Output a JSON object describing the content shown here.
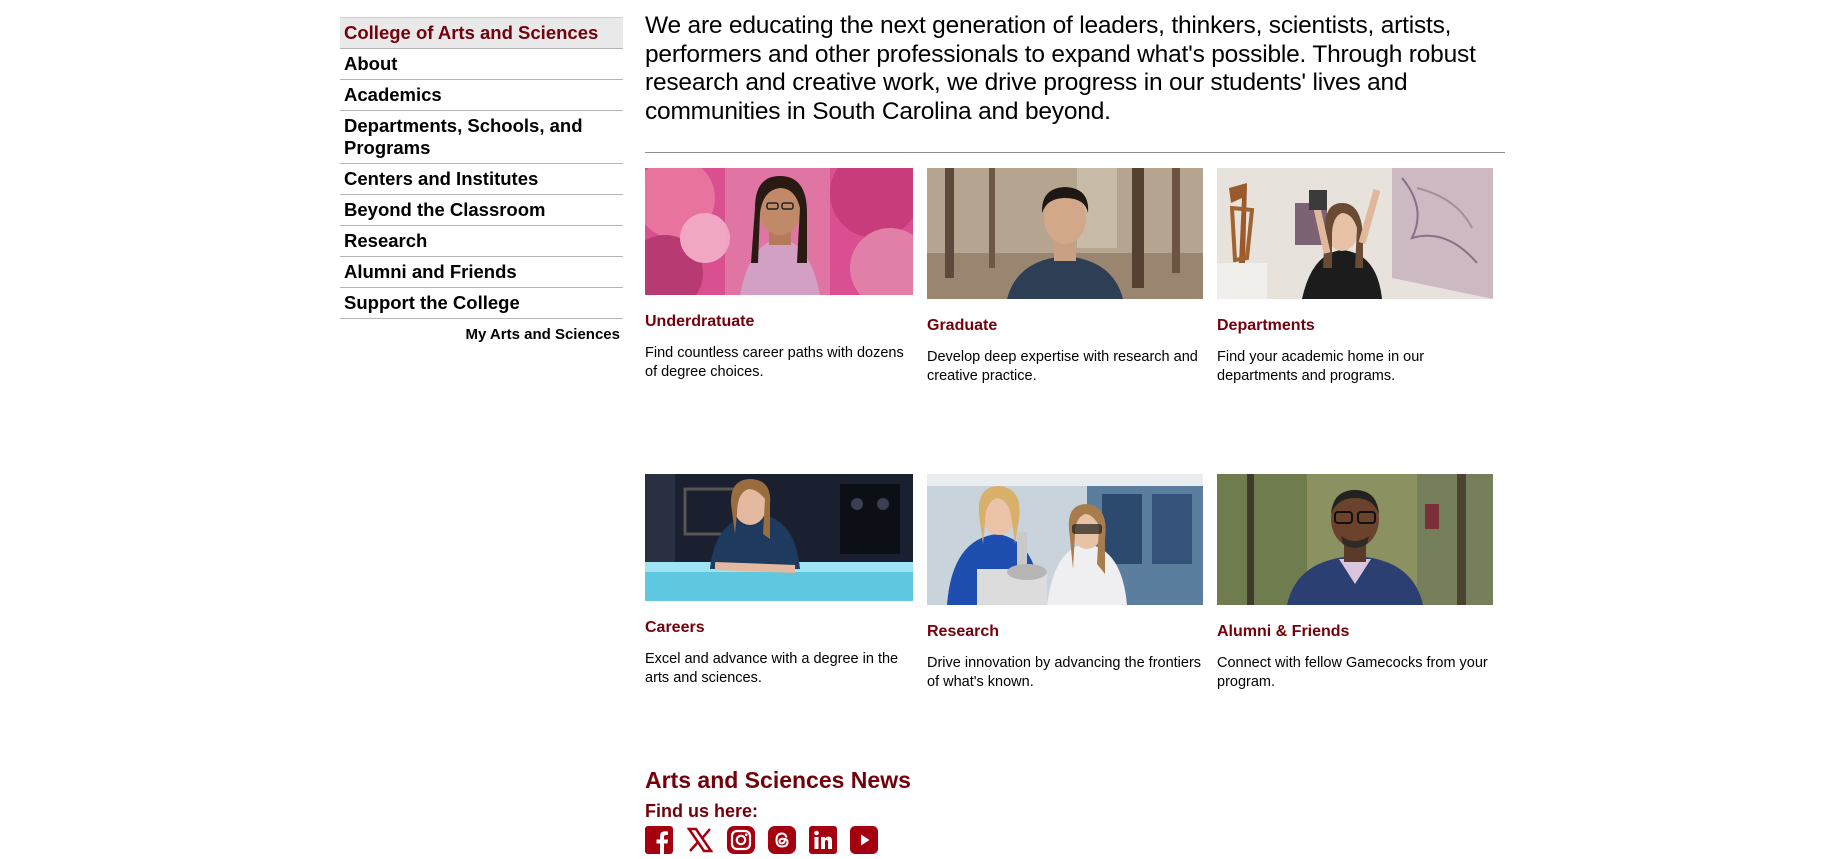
{
  "sidebar": {
    "items": [
      {
        "label": "College of Arts and Sciences"
      },
      {
        "label": "About"
      },
      {
        "label": "Academics"
      },
      {
        "label": "Departments, Schools, and Programs"
      },
      {
        "label": "Centers and Institutes"
      },
      {
        "label": "Beyond the Classroom"
      },
      {
        "label": "Research"
      },
      {
        "label": "Alumni and Friends"
      },
      {
        "label": "Support the College"
      }
    ],
    "my_link": "My Arts and Sciences"
  },
  "main": {
    "intro": "We are educating the next generation of leaders, thinkers, scientists, artists, performers and other professionals to expand what's possible. Through robust research and creative work, we drive progress in our students' lives and communities in South Carolina and beyond.",
    "cards": [
      {
        "title": "Underdratuate",
        "desc": "Find countless career paths with dozens of degree choices."
      },
      {
        "title": "Graduate",
        "desc": "Develop deep expertise with research and creative practice."
      },
      {
        "title": "Departments",
        "desc": "Find your academic home in our departments and programs."
      },
      {
        "title": "Careers",
        "desc": "Excel and advance with a degree in the arts and sciences."
      },
      {
        "title": "Research",
        "desc": "Drive innovation by advancing the frontiers of what's known."
      },
      {
        "title": "Alumni & Friends",
        "desc": "Connect with fellow Gamecocks from your program."
      }
    ]
  },
  "news": {
    "title": "Arts and Sciences News",
    "find_us": "Find us here:",
    "socials": [
      "facebook-icon",
      "x-icon",
      "instagram-icon",
      "threads-icon",
      "linkedin-icon",
      "youtube-icon"
    ]
  },
  "colors": {
    "garnet": "#73000a",
    "icon_red": "#a5000f"
  }
}
